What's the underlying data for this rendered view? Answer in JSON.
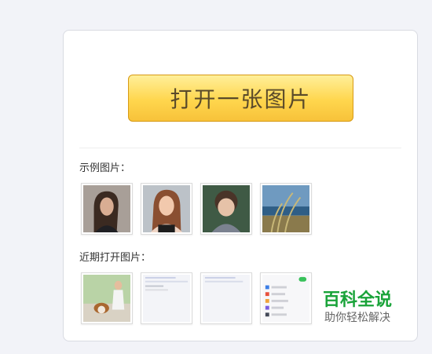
{
  "open_button": {
    "label": "打开一张图片"
  },
  "sections": {
    "examples_label": "示例图片：",
    "recent_label": "近期打开图片："
  },
  "example_images": [
    {
      "icon": "portrait-woman-brunette-thumbnail"
    },
    {
      "icon": "portrait-woman-smiling-thumbnail"
    },
    {
      "icon": "portrait-child-thumbnail"
    },
    {
      "icon": "landscape-grass-sea-thumbnail"
    }
  ],
  "recent_images": [
    {
      "icon": "woman-with-dog-thumbnail"
    },
    {
      "icon": "document-screenshot-thumbnail"
    },
    {
      "icon": "blank-page-thumbnail"
    },
    {
      "icon": "settings-screenshot-thumbnail"
    }
  ],
  "watermark": {
    "title": "百科全说",
    "subtitle": "助你轻松解决"
  },
  "colors": {
    "button_gradient_top": "#ffef9a",
    "button_gradient_bottom": "#f7c23a",
    "button_border": "#d79a14",
    "watermark_green": "#19a339"
  }
}
